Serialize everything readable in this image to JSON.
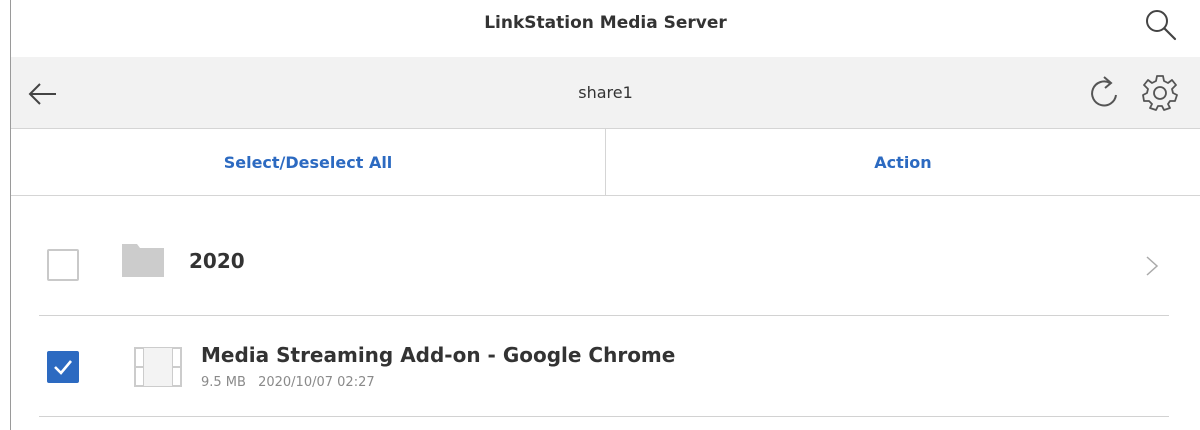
{
  "header": {
    "app_title": "LinkStation Media Server",
    "search_icon": "search-icon"
  },
  "navbar": {
    "back_icon": "arrow-left-icon",
    "current_folder": "share1",
    "refresh_icon": "refresh-icon",
    "settings_icon": "gear-icon"
  },
  "actions": {
    "select_all_label": "Select/Deselect All",
    "action_label": "Action"
  },
  "list": {
    "items": [
      {
        "type": "folder",
        "name": "2020",
        "checked": false,
        "icon": "folder-icon"
      },
      {
        "type": "video",
        "name": "Media Streaming Add-on - Google Chrome",
        "size": "9.5 MB",
        "date": "2020/10/07 02:27",
        "checked": true,
        "icon": "film-icon"
      }
    ]
  },
  "colors": {
    "accent": "#2c6ac1",
    "nav_background": "#f2f2f2",
    "icon_gray": "#cccccc"
  }
}
